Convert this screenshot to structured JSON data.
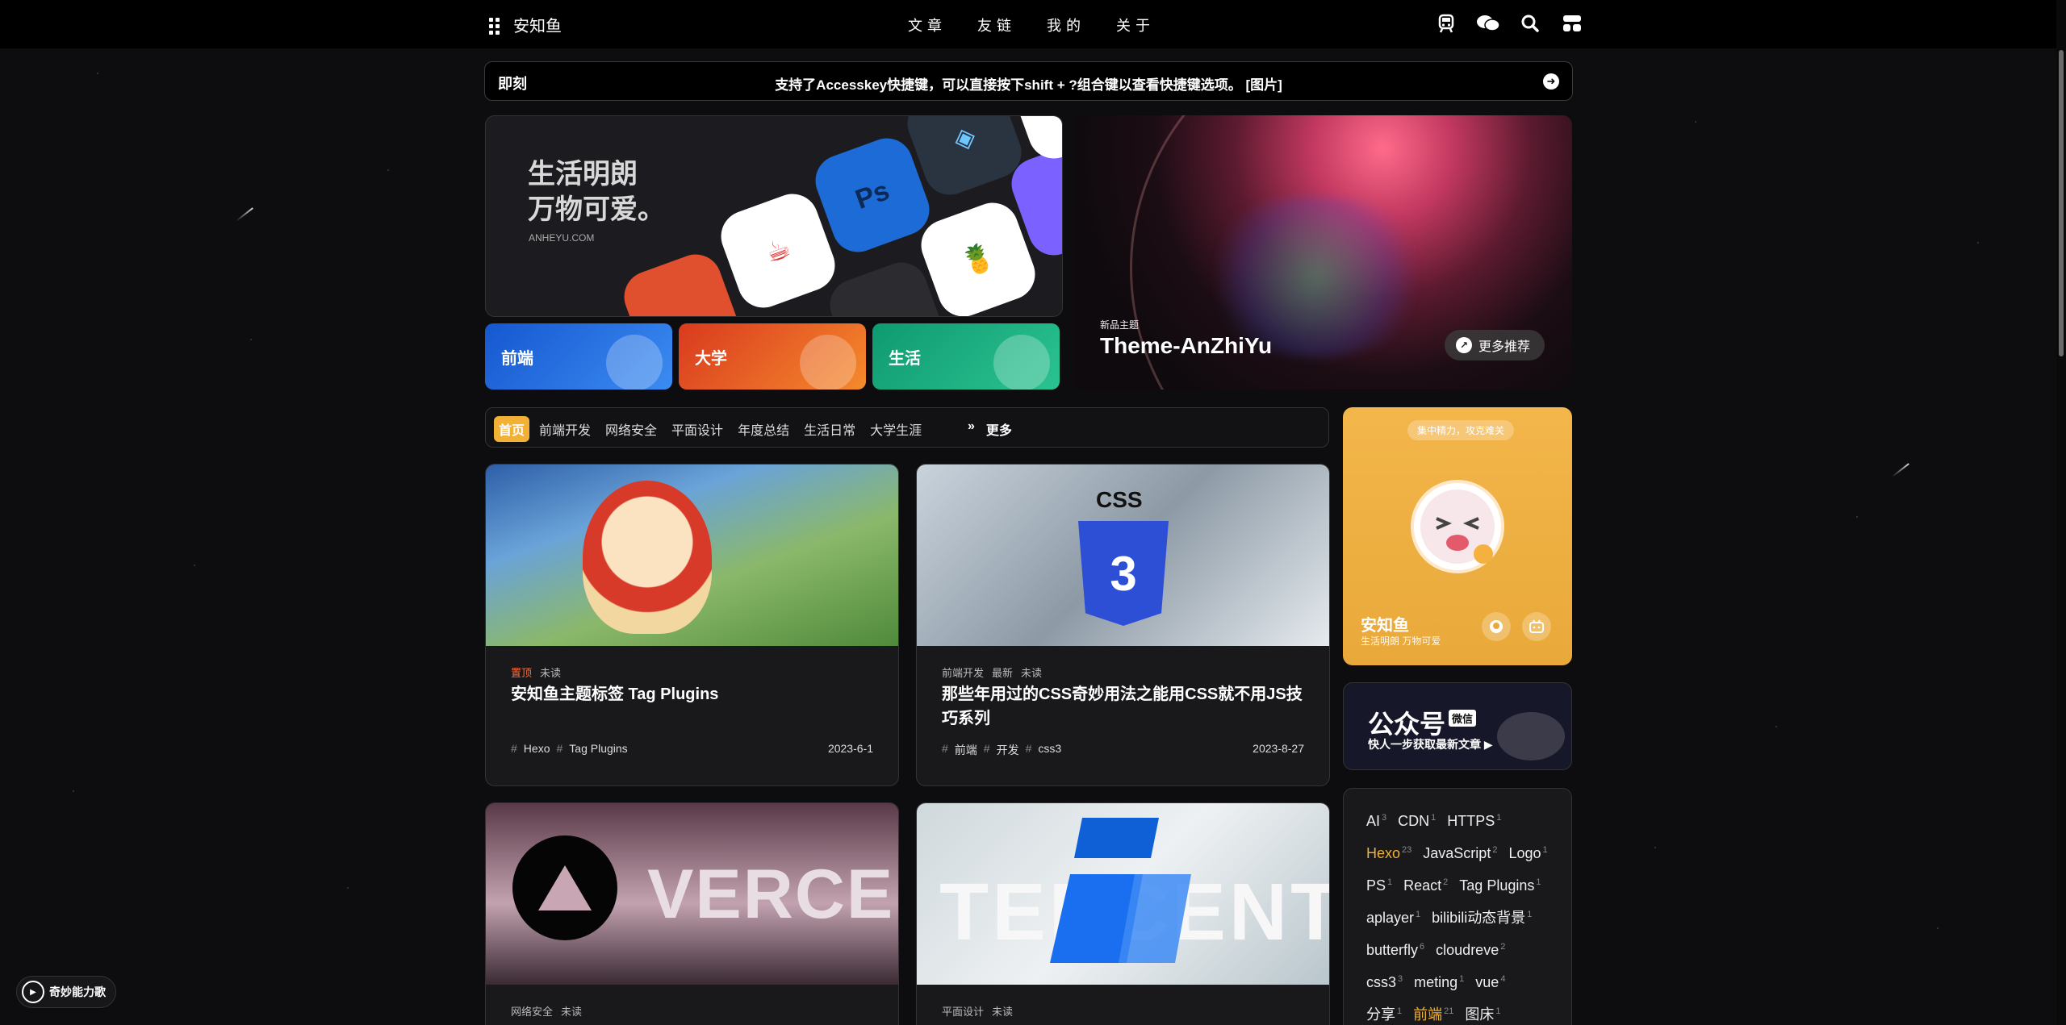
{
  "nav": {
    "brand": "安知鱼",
    "menu": [
      "文章",
      "友链",
      "我的",
      "关于"
    ],
    "tools": [
      "subway-icon",
      "chat-icon",
      "search-icon",
      "console-icon"
    ]
  },
  "bulletin": {
    "tag": "即刻",
    "message": "支持了Accesskey快捷键，可以直接按下shift + ?组合键以查看快捷键选项。 [图片]"
  },
  "hero_left": {
    "slogan_line1": "生活明朗",
    "slogan_line2": "万物可爱。",
    "site": "ANHEYU.COM"
  },
  "categories_tiles": [
    {
      "label": "前端",
      "color": "#1f6fe0"
    },
    {
      "label": "大学",
      "color": "#e65a27"
    },
    {
      "label": "生活",
      "color": "#1aa67a"
    }
  ],
  "hero_right": {
    "subtitle": "新品主题",
    "title": "Theme-AnZhiYu",
    "more": "更多推荐"
  },
  "catbar": {
    "items": [
      "首页",
      "前端开发",
      "网络安全",
      "平面设计",
      "年度总结",
      "生活日常",
      "大学生涯"
    ],
    "active": 0,
    "more": "更多"
  },
  "posts": [
    {
      "meta": [
        "置顶",
        "未读"
      ],
      "title": "安知鱼主题标签 Tag Plugins",
      "tags": [
        "Hexo",
        "Tag Plugins"
      ],
      "date": "2023-6-1"
    },
    {
      "meta": [
        "前端开发",
        "最新",
        "未读"
      ],
      "title": "那些年用过的CSS奇妙用法之能用CSS就不用JS技巧系列",
      "tags": [
        "前端",
        "开发",
        "css3"
      ],
      "date": "2023-8-27"
    },
    {
      "meta": [
        "网络安全",
        "未读"
      ],
      "cover_text": "VERCEL"
    },
    {
      "meta": [
        "平面设计",
        "未读"
      ],
      "cover_text": "TENCENT"
    }
  ],
  "profile": {
    "pill": "集中精力，攻克难关",
    "name": "安知鱼",
    "desc": "生活明朗 万物可爱"
  },
  "wechat": {
    "big": "公众号",
    "badge": "微信",
    "sub": "快人一步获取最新文章 ▶"
  },
  "tags": [
    {
      "name": "AI",
      "count": "3"
    },
    {
      "name": "CDN",
      "count": "1"
    },
    {
      "name": "HTTPS",
      "count": "1"
    },
    {
      "name": "Hexo",
      "count": "23",
      "hl": true
    },
    {
      "name": "JavaScript",
      "count": "2"
    },
    {
      "name": "Logo",
      "count": "1"
    },
    {
      "name": "PS",
      "count": "1"
    },
    {
      "name": "React",
      "count": "2"
    },
    {
      "name": "Tag Plugins",
      "count": "1"
    },
    {
      "name": "aplayer",
      "count": "1"
    },
    {
      "name": "bilibili动态背景",
      "count": "1"
    },
    {
      "name": "butterfly",
      "count": "6"
    },
    {
      "name": "cloudreve",
      "count": "2"
    },
    {
      "name": "css3",
      "count": "3"
    },
    {
      "name": "meting",
      "count": "1"
    },
    {
      "name": "vue",
      "count": "4"
    },
    {
      "name": "分享",
      "count": "1"
    },
    {
      "name": "前端",
      "count": "21",
      "hl": true
    },
    {
      "name": "图床",
      "count": "1"
    }
  ],
  "music": {
    "label": "奇妙能力歌"
  }
}
